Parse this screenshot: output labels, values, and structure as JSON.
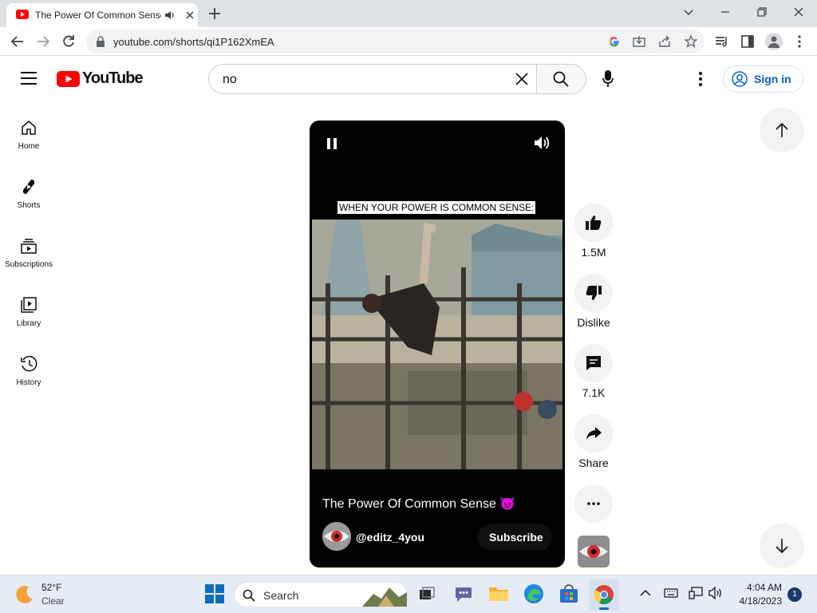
{
  "browser": {
    "tab_title": "The Power Of Common Sense",
    "url": "youtube.com/shorts/qi1P162XmEA"
  },
  "youtube": {
    "logo_text": "YouTube",
    "search_value": "no",
    "signin_label": "Sign in"
  },
  "sidebar": {
    "items": [
      {
        "label": "Home",
        "icon": "home-icon"
      },
      {
        "label": "Shorts",
        "icon": "shorts-icon"
      },
      {
        "label": "Subscriptions",
        "icon": "subscriptions-icon"
      },
      {
        "label": "Library",
        "icon": "library-icon"
      },
      {
        "label": "History",
        "icon": "history-icon"
      }
    ]
  },
  "short": {
    "caption": "WHEN YOUR POWER IS COMMON SENSE:",
    "title": "The Power Of Common Sense 😈",
    "channel": "@editz_4you",
    "subscribe_label": "Subscribe"
  },
  "actions": {
    "likes": "1.5M",
    "dislike_label": "Dislike",
    "comments": "7.1K",
    "share_label": "Share"
  },
  "taskbar": {
    "weather_temp": "52°F",
    "weather_condition": "Clear",
    "search_label": "Search",
    "time": "4:04 AM",
    "date": "4/18/2023",
    "notification_count": "1"
  },
  "colors": {
    "youtube_red": "#ff0000",
    "signin_blue": "#065fd4"
  }
}
